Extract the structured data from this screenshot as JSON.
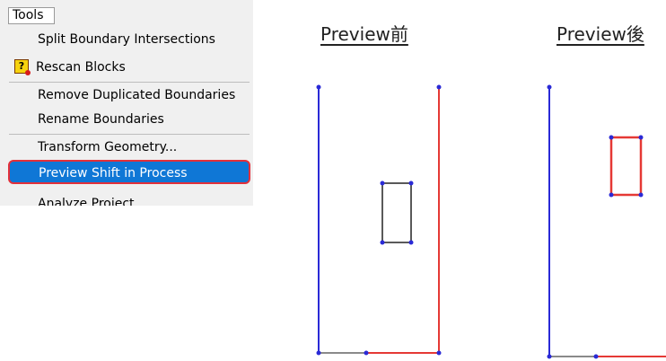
{
  "menu": {
    "header": "Tools",
    "items": [
      {
        "label": "Split Boundary Intersections"
      },
      {
        "label": "Rescan Blocks",
        "icon": "rescan-blocks-icon"
      },
      {
        "label": "Remove Duplicated Boundaries"
      },
      {
        "label": "Rename Boundaries"
      },
      {
        "label": "Transform Geometry..."
      },
      {
        "label": "Preview Shift in Process",
        "selected": true
      },
      {
        "label": "Analyze Project"
      }
    ]
  },
  "preview": {
    "before_label": "Preview前",
    "after_label": "Preview後"
  },
  "colors": {
    "selection": "#0f77d6",
    "highlight_border": "#e3303a",
    "boundary_blue": "#2a2ad6",
    "boundary_red": "#e53935",
    "boundary_gray": "#8a8a8a"
  }
}
